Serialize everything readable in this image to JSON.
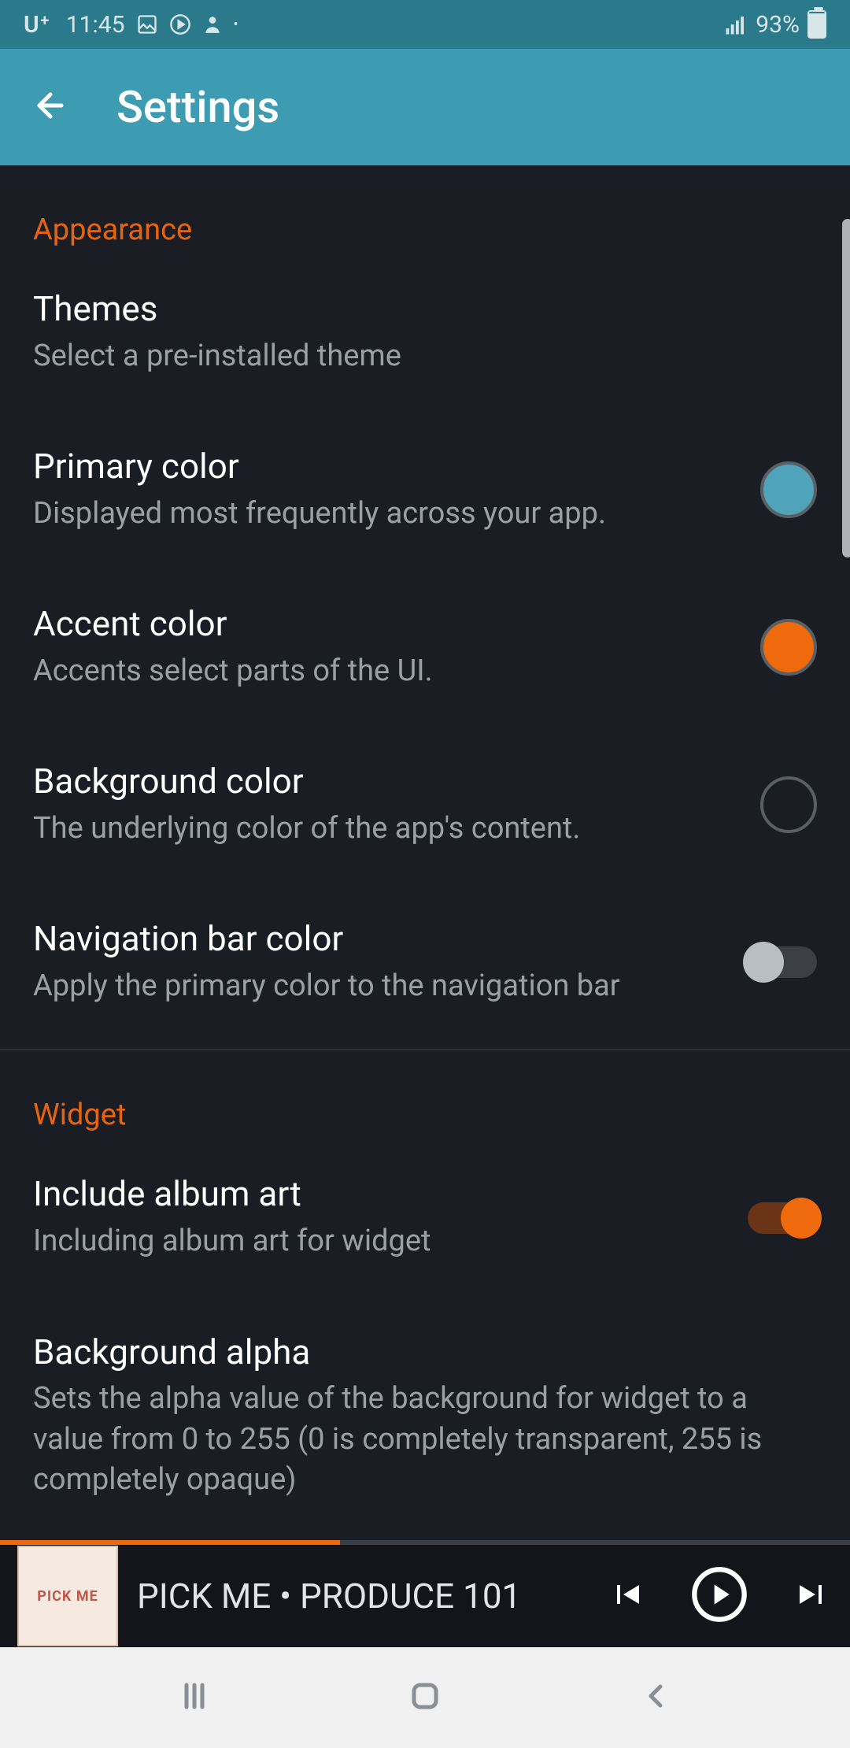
{
  "status_bar": {
    "carrier": "U⁺",
    "time": "11:45",
    "battery_pct": "93%"
  },
  "app_bar": {
    "title": "Settings"
  },
  "sections": {
    "appearance": {
      "header": "Appearance",
      "themes": {
        "title": "Themes",
        "sub": "Select a pre-installed theme"
      },
      "primary_color": {
        "title": "Primary color",
        "sub": "Displayed most frequently across your app.",
        "color": "#4fa4bc"
      },
      "accent_color": {
        "title": "Accent color",
        "sub": "Accents select parts of the UI.",
        "color": "#ee6a0c"
      },
      "background_color": {
        "title": "Background color",
        "sub": "The underlying color of the app's content.",
        "color": "#1a1d24"
      },
      "nav_bar_color": {
        "title": "Navigation bar color",
        "sub": "Apply the primary color to the navigation bar",
        "enabled": false
      }
    },
    "widget": {
      "header": "Widget",
      "include_album_art": {
        "title": "Include album art",
        "sub": "Including album art for widget",
        "enabled": true
      },
      "background_alpha": {
        "title": "Background alpha",
        "sub": "Sets the alpha value of the background for widget to a value from 0 to 255 (0 is completely transparent, 255 is completely opaque)"
      }
    }
  },
  "mini_player": {
    "album_label": "PICK ME",
    "track": "PICK ME • PRODUCE 101",
    "progress_pct": 40
  }
}
